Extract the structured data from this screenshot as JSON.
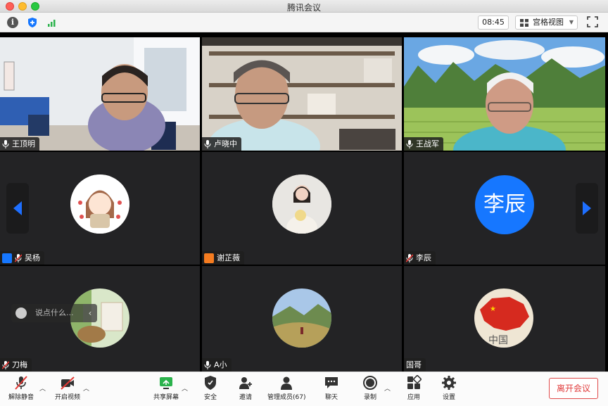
{
  "window": {
    "title": "腾讯会议"
  },
  "topbar": {
    "clock": "08:45",
    "view_label": "宫格视图"
  },
  "participants": [
    {
      "name": "王顶明"
    },
    {
      "name": "卢晓中"
    },
    {
      "name": "王战军"
    },
    {
      "name": "吴杨"
    },
    {
      "name": "谢芷薇"
    },
    {
      "name": "李辰",
      "avatar_text": "李辰"
    },
    {
      "name": "刀梅"
    },
    {
      "name": "A小"
    },
    {
      "name": "国哥"
    }
  ],
  "chat": {
    "placeholder": "说点什么..."
  },
  "toolbar": {
    "unmute": "解除静音",
    "start_video": "开启视频",
    "share_screen": "共享屏幕",
    "security": "安全",
    "invite": "邀请",
    "members": "管理成员(67)",
    "chat": "聊天",
    "record": "录制",
    "apps": "应用",
    "settings": "设置",
    "leave": "离开会议"
  },
  "colors": {
    "accent_green": "#2bd05c",
    "avatar_blue": "#1677ff",
    "leave_red": "#e03b3b"
  }
}
